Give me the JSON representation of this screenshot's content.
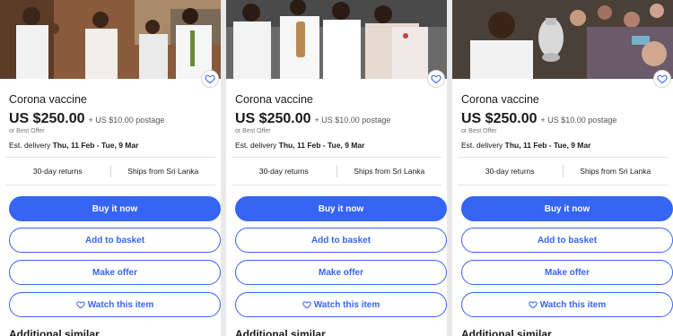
{
  "listings": [
    {
      "title": "Corona vaccine",
      "price": "US $250.00",
      "postage": "+ US $10.00 postage",
      "best_offer": "or Best Offer",
      "delivery_label": "Est. delivery",
      "delivery_dates": "Thu, 11 Feb - Tue, 9 Mar",
      "returns": "30-day returns",
      "ships_from": "Ships from Sri Lanka",
      "buy_now": "Buy it now",
      "add_to_basket": "Add to basket",
      "make_offer": "Make offer",
      "watch": "Watch this item",
      "photo_icon": "photo-men-in-office",
      "truncated_heading": "Additional similar ..."
    },
    {
      "title": "Corona vaccine",
      "price": "US $250.00",
      "postage": "+ US $10.00 postage",
      "best_offer": "or Best Offer",
      "delivery_label": "Est. delivery",
      "delivery_dates": "Thu, 11 Feb - Tue, 9 Mar",
      "returns": "30-day returns",
      "ships_from": "Ships from Sri Lanka",
      "buy_now": "Buy it now",
      "add_to_basket": "Add to basket",
      "make_offer": "Make offer",
      "watch": "Watch this item",
      "photo_icon": "photo-group-with-bottle",
      "truncated_heading": "Additional similar ..."
    },
    {
      "title": "Corona vaccine",
      "price": "US $250.00",
      "postage": "+ US $10.00 postage",
      "best_offer": "or Best Offer",
      "delivery_label": "Est. delivery",
      "delivery_dates": "Thu, 11 Feb - Tue, 9 Mar",
      "returns": "30-day returns",
      "ships_from": "Ships from Sri Lanka",
      "buy_now": "Buy it now",
      "add_to_basket": "Add to basket",
      "make_offer": "Make offer",
      "watch": "Watch this item",
      "photo_icon": "photo-man-with-pot-crowd",
      "truncated_heading": "Additional similar ..."
    }
  ],
  "colors": {
    "accent": "#3665f3",
    "text": "#191919",
    "muted": "#767676",
    "divider": "#e5e5e5"
  }
}
